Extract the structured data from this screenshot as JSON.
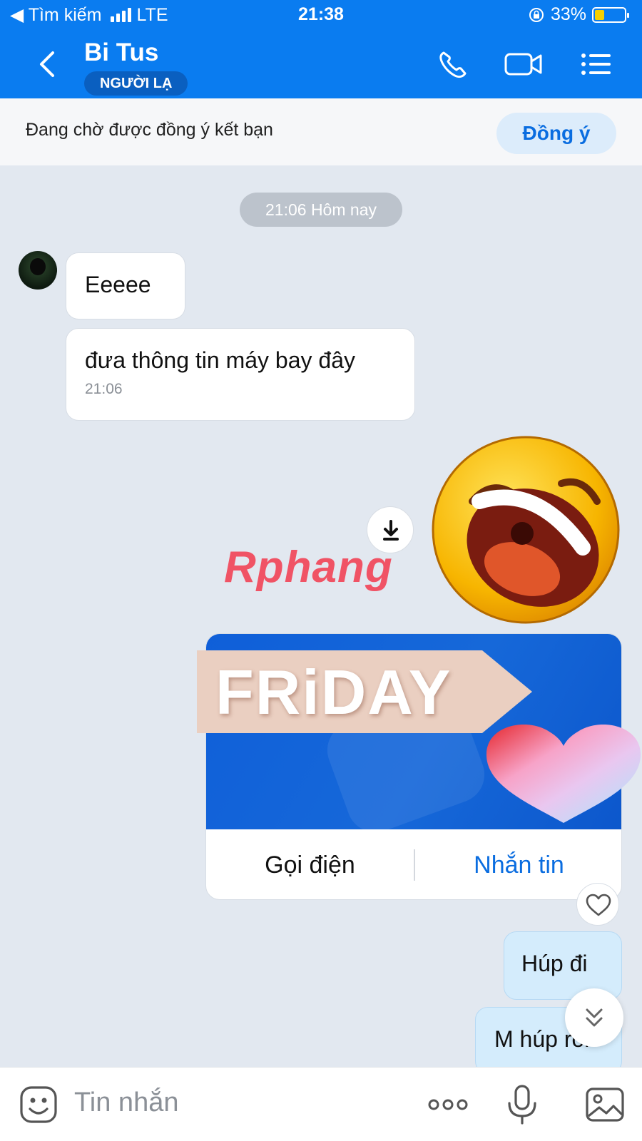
{
  "status_bar": {
    "carrier": "◀ Tìm kiếm",
    "network": "LTE",
    "time": "21:38",
    "battery_percent": "33%",
    "battery_level": 0.33
  },
  "header": {
    "contact_name": "Bi Tus",
    "badge": "NGƯỜI LẠ"
  },
  "friend_request": {
    "text": "Đang chờ được đồng ý kết bạn",
    "accept_label": "Đồng ý"
  },
  "chat": {
    "time_divider": "21:06 Hôm nay",
    "incoming": [
      {
        "text": "Eeeee"
      },
      {
        "text": "đưa thông tin máy bay đây",
        "time": "21:06"
      }
    ],
    "watermark": "Rphang",
    "sticker_text": "FRiDAY",
    "card": {
      "call_label": "Gọi điện",
      "message_label": "Nhắn tin"
    },
    "outgoing": [
      {
        "text": "Húp đi"
      },
      {
        "text": "M húp rồi"
      }
    ]
  },
  "input": {
    "placeholder": "Tin nhắn"
  },
  "colors": {
    "header_bg": "#0a7cf0",
    "accent": "#0a6de0",
    "chat_bg": "#e2e8f0",
    "outgoing_bubble": "#d4ecfc"
  },
  "icons": [
    "back-icon",
    "phone-icon",
    "video-icon",
    "menu-icon",
    "download-icon",
    "heart-icon",
    "chevron-double-down-icon",
    "emoji-icon",
    "more-icon",
    "microphone-icon",
    "image-icon"
  ]
}
